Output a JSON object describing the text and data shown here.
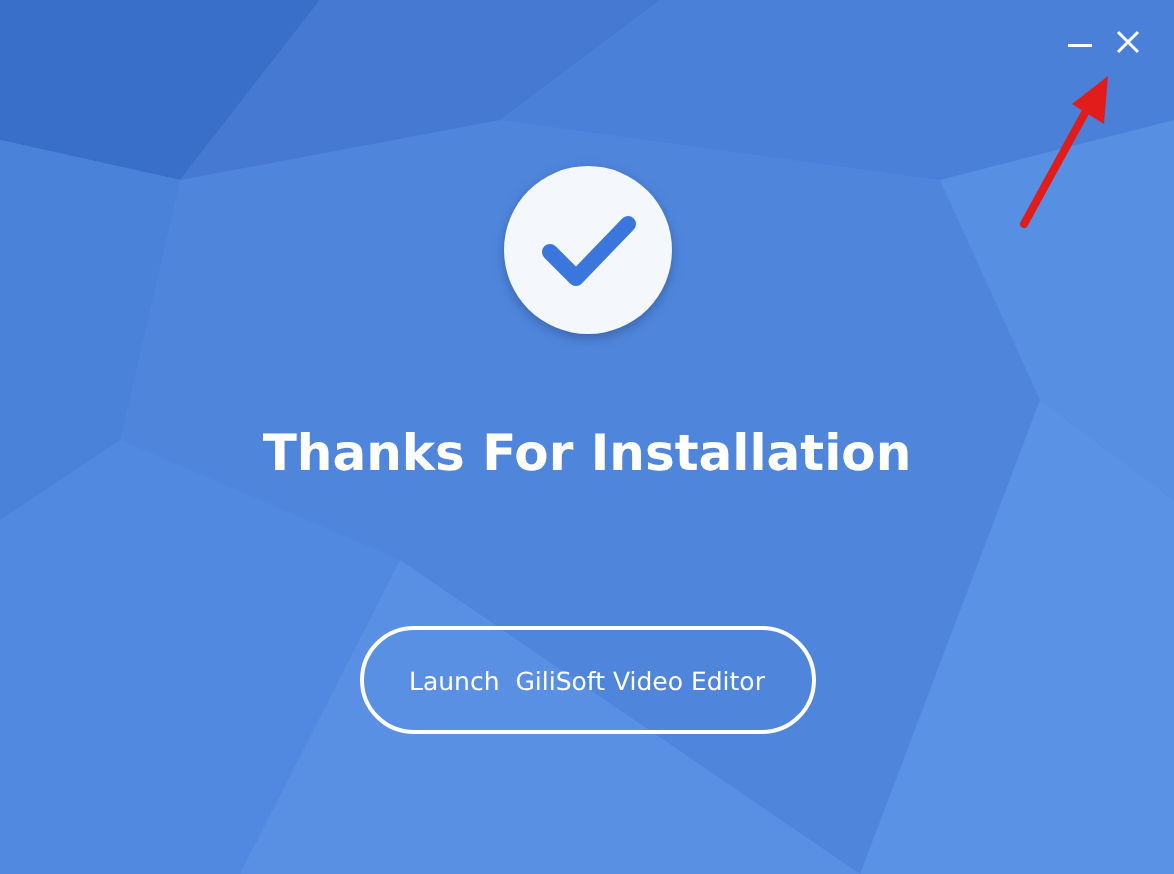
{
  "window": {
    "controls": [
      {
        "kind": "minimize"
      },
      {
        "kind": "close"
      }
    ]
  },
  "title": "Thanks For Installation",
  "launch_button": {
    "label": "Launch  GiliSoft Video Editor"
  }
}
